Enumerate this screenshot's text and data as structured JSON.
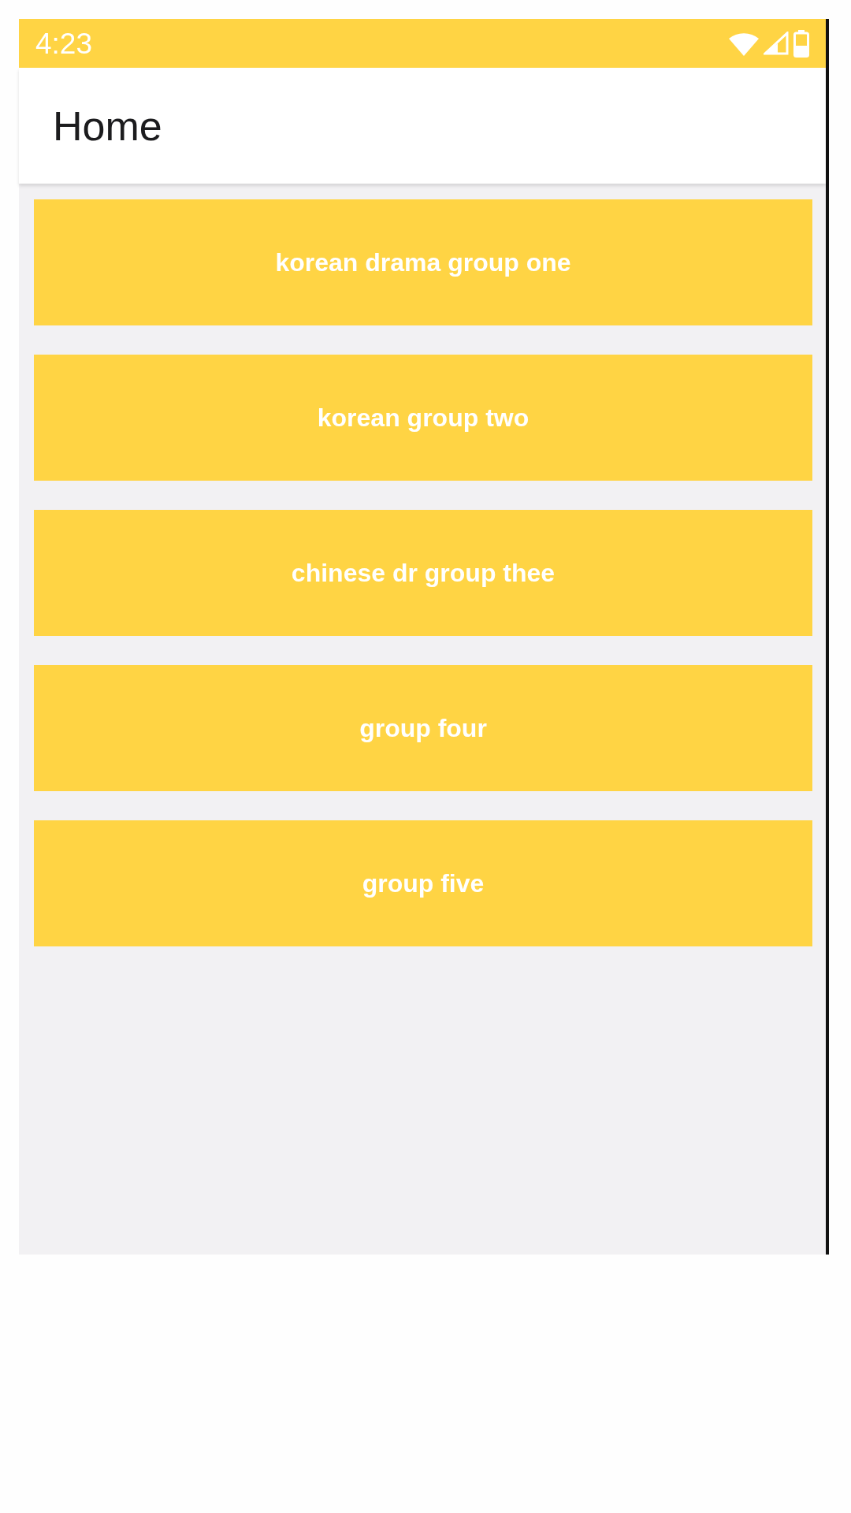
{
  "status_bar": {
    "time": "4:23"
  },
  "app_bar": {
    "title": "Home"
  },
  "groups": [
    {
      "label": "korean drama group one"
    },
    {
      "label": "korean group two"
    },
    {
      "label": "chinese dr group thee"
    },
    {
      "label": "group four"
    },
    {
      "label": "group five"
    }
  ]
}
